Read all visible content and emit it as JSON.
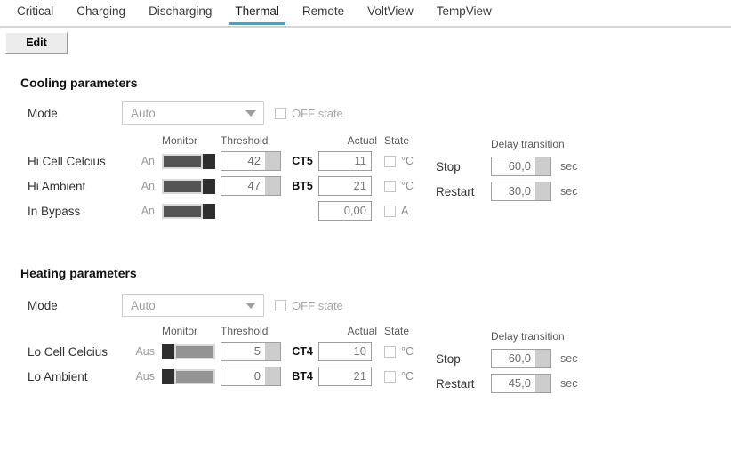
{
  "tabs": [
    {
      "label": "Critical",
      "active": false
    },
    {
      "label": "Charging",
      "active": false
    },
    {
      "label": "Discharging",
      "active": false
    },
    {
      "label": "Thermal",
      "active": true
    },
    {
      "label": "Remote",
      "active": false
    },
    {
      "label": "VoltView",
      "active": false
    },
    {
      "label": "TempView",
      "active": false
    }
  ],
  "accent_color": "#29abe2",
  "toolbar": {
    "edit_label": "Edit"
  },
  "column_headers": {
    "monitor": "Monitor",
    "threshold": "Threshold",
    "actual": "Actual",
    "state": "State",
    "delay_transition": "Delay transition"
  },
  "cooling": {
    "title": "Cooling parameters",
    "mode_label": "Mode",
    "mode_value": "Auto",
    "off_state_label": "OFF state",
    "off_state_checked": false,
    "rows": [
      {
        "label": "Hi Cell Celcius",
        "monitor_state": "An",
        "toggle": "on",
        "threshold": "42",
        "has_threshold": true,
        "tag": "CT5",
        "actual": "11",
        "unit": "°C",
        "state_checked": false
      },
      {
        "label": "Hi Ambient",
        "monitor_state": "An",
        "toggle": "on",
        "threshold": "47",
        "has_threshold": true,
        "tag": "BT5",
        "actual": "21",
        "unit": "°C",
        "state_checked": false
      },
      {
        "label": "In Bypass",
        "monitor_state": "An",
        "toggle": "on",
        "threshold": "",
        "has_threshold": false,
        "tag": "",
        "actual": "0,00",
        "unit": "A",
        "state_checked": false
      }
    ],
    "delay": [
      {
        "label": "Stop",
        "value": "60,0",
        "unit": "sec"
      },
      {
        "label": "Restart",
        "value": "30,0",
        "unit": "sec"
      }
    ]
  },
  "heating": {
    "title": "Heating parameters",
    "mode_label": "Mode",
    "mode_value": "Auto",
    "off_state_label": "OFF state",
    "off_state_checked": false,
    "rows": [
      {
        "label": "Lo Cell Celcius",
        "monitor_state": "Aus",
        "toggle": "off",
        "threshold": "5",
        "has_threshold": true,
        "tag": "CT4",
        "actual": "10",
        "unit": "°C",
        "state_checked": false
      },
      {
        "label": "Lo Ambient",
        "monitor_state": "Aus",
        "toggle": "off",
        "threshold": "0",
        "has_threshold": true,
        "tag": "BT4",
        "actual": "21",
        "unit": "°C",
        "state_checked": false
      }
    ],
    "delay": [
      {
        "label": "Stop",
        "value": "60,0",
        "unit": "sec"
      },
      {
        "label": "Restart",
        "value": "45,0",
        "unit": "sec"
      }
    ]
  }
}
